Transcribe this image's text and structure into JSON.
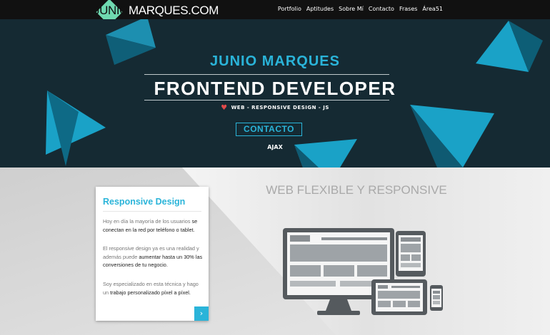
{
  "logo": {
    "part1": "JUNIO",
    "part2": "MARQUES",
    "part3": ".COM"
  },
  "nav": {
    "items": [
      "Portfolio",
      "Aptitudes",
      "Sobre Mí",
      "Contacto",
      "Frases",
      "Área51"
    ]
  },
  "hero": {
    "name": "JUNIO MARQUES",
    "title": "FRONTEND DEVELOPER",
    "subtitle": "WEB - RESPONSIVE DESIGN - JS",
    "cta": "CONTACTO",
    "tag": "AJAX"
  },
  "card": {
    "title": "Responsive Design",
    "p1_a": "Hoy en día la mayoría de los usuarios ",
    "p1_b": "se conectan en la red por teléfono o tablet.",
    "p2_a": "El responsive design ya es una realidad y además puede ",
    "p2_b": "aumentar hasta un 30% las conversiones de tu negocio.",
    "p3_a": "Soy especializado en esta técnica y hago un ",
    "p3_b": "trabajo personalizado píxel a píxel.",
    "arrow": "›"
  },
  "section": {
    "title": "WEB FLEXIBLE Y RESPONSIVE"
  },
  "colors": {
    "accent": "#2ab4d9",
    "hero_bg": "#152a33",
    "nav_bg": "#111111",
    "heart": "#e04a4a",
    "device": "#555a5e"
  }
}
